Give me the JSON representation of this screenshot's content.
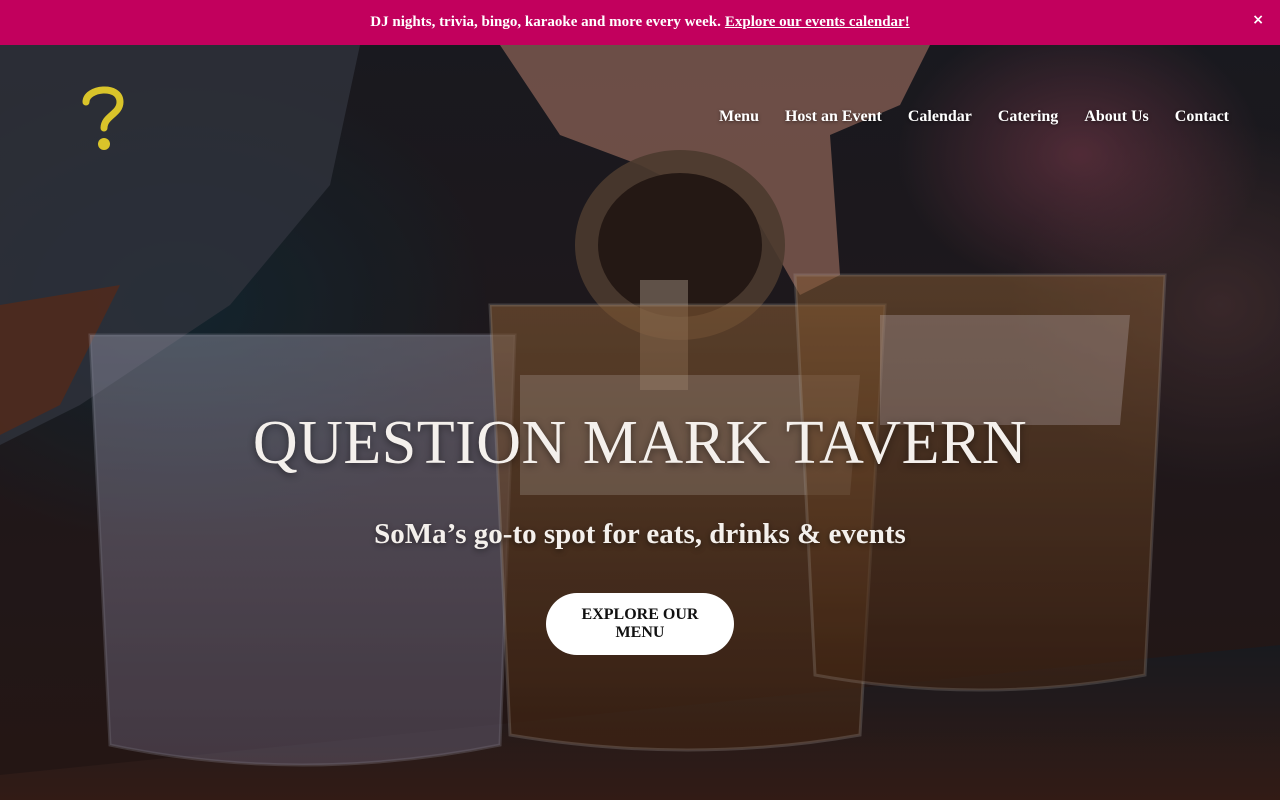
{
  "announcement": {
    "message": "DJ nights, trivia, bingo, karaoke and more every week.",
    "link_text": "Explore our events calendar!",
    "close_glyph": "×",
    "background_color": "#c2005d"
  },
  "logo": {
    "icon": "question-mark-logo-icon",
    "color": "#d9c42a"
  },
  "nav": {
    "items": [
      {
        "label": "Menu"
      },
      {
        "label": "Host an Event"
      },
      {
        "label": "Calendar"
      },
      {
        "label": "Catering"
      },
      {
        "label": "About Us"
      },
      {
        "label": "Contact"
      }
    ]
  },
  "hero": {
    "title": "QUESTION MARK TAVERN",
    "subtitle": "SoMa’s go-to spot for eats, drinks & events",
    "cta_label": "EXPLORE OUR MENU",
    "background": "photo-bartender-pouring-whiskey-over-ice"
  }
}
